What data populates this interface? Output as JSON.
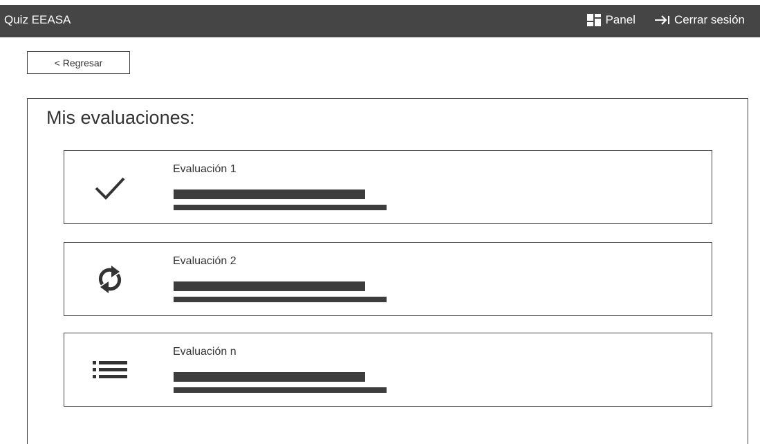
{
  "header": {
    "title": "Quiz EEASA",
    "nav": [
      {
        "label": "Panel",
        "icon": "dashboard-icon"
      },
      {
        "label": "Cerrar sesión",
        "icon": "logout-icon"
      }
    ]
  },
  "back_button": {
    "label": "< Regresar"
  },
  "main": {
    "title": "Mis evaluaciones:",
    "evaluations": [
      {
        "title": "Evaluación 1",
        "icon": "check-icon"
      },
      {
        "title": "Evaluación 2",
        "icon": "refresh-icon"
      },
      {
        "title": "Evaluación n",
        "icon": "list-icon"
      }
    ]
  },
  "colors": {
    "navbar_bg": "#454545",
    "border": "#444444",
    "text": "#333333",
    "bar": "#3d3d3d"
  }
}
